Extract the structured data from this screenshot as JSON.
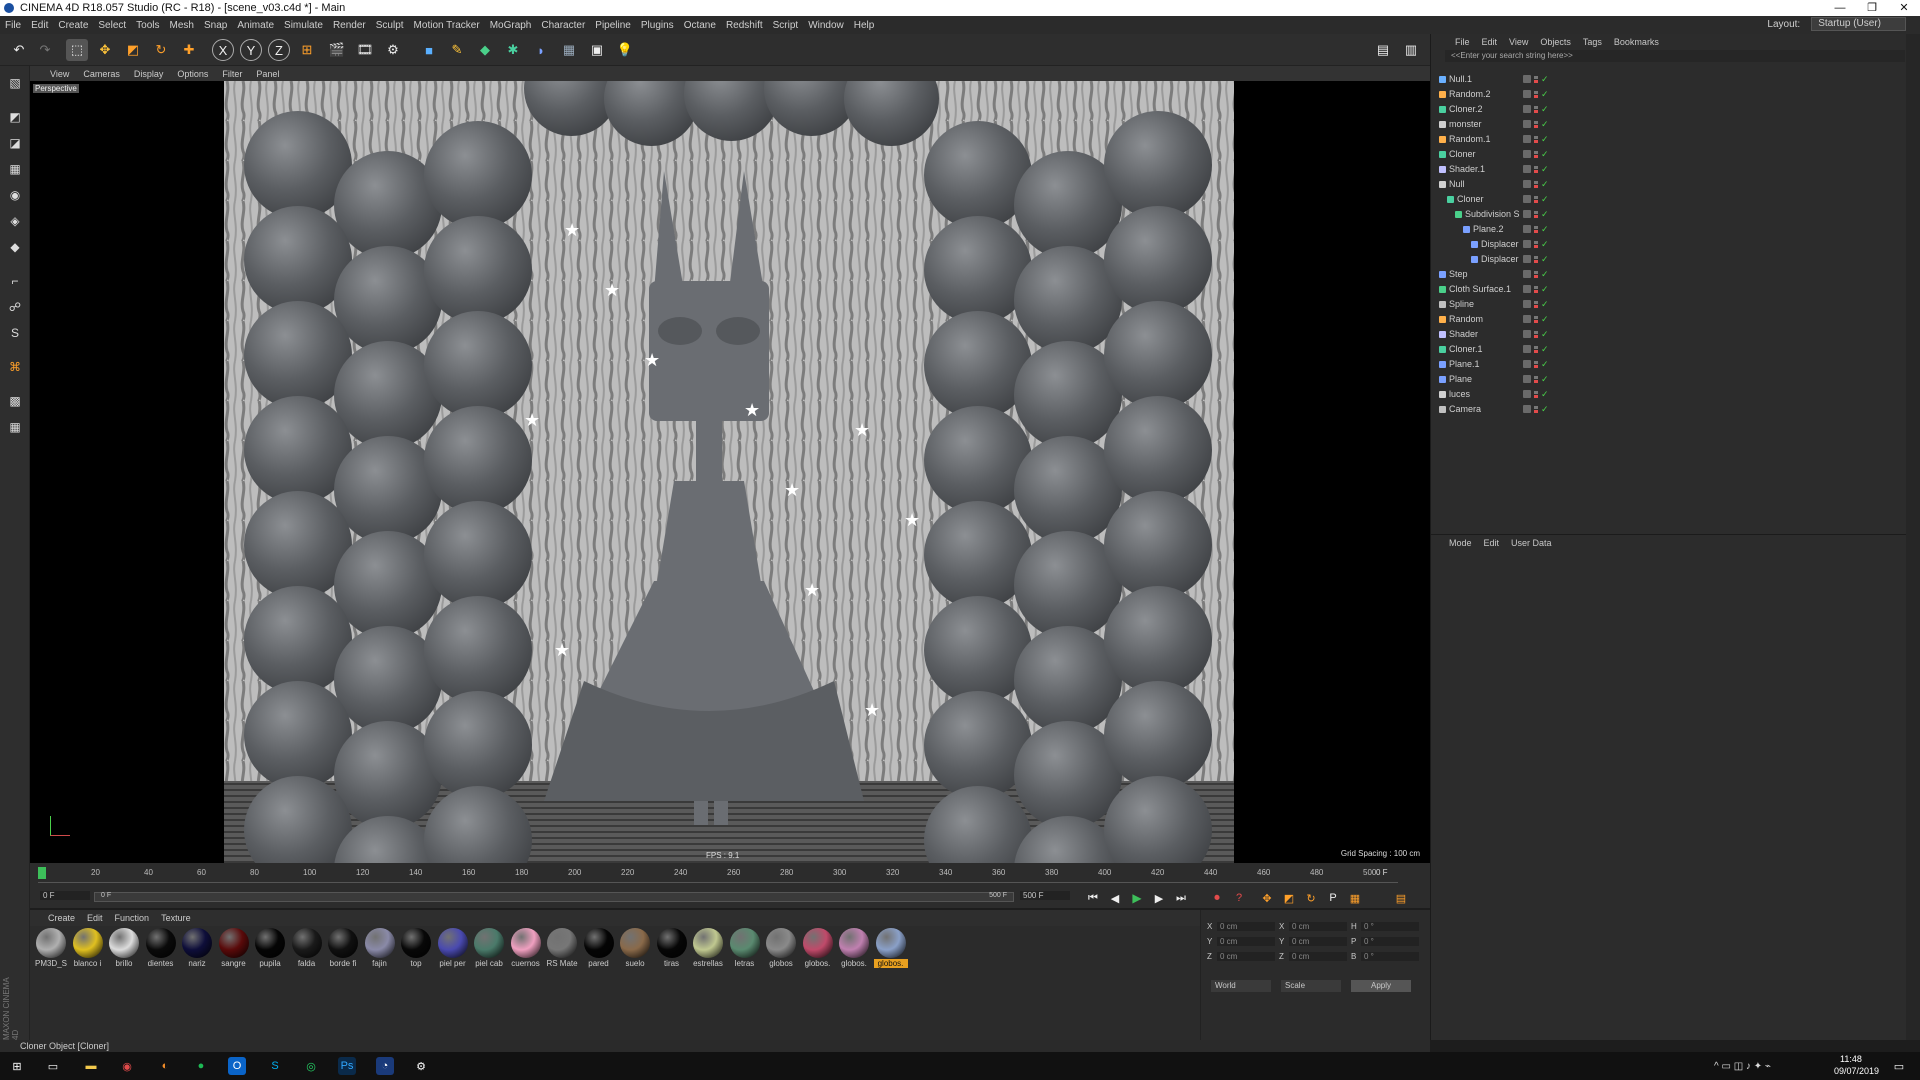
{
  "window": {
    "title": "CINEMA 4D R18.057 Studio (RC - R18) - [scene_v03.c4d *] - Main",
    "controls": [
      "—",
      "❐",
      "✕"
    ]
  },
  "menu": [
    "File",
    "Edit",
    "Create",
    "Select",
    "Tools",
    "Mesh",
    "Snap",
    "Animate",
    "Simulate",
    "Render",
    "Sculpt",
    "Motion Tracker",
    "MoGraph",
    "Character",
    "Pipeline",
    "Plugins",
    "Octane",
    "Redshift",
    "Script",
    "Window",
    "Help"
  ],
  "layout": {
    "label": "Layout:",
    "value": "Startup (User)"
  },
  "viewport": {
    "menu": [
      "View",
      "Cameras",
      "Display",
      "Options",
      "Filter",
      "Panel"
    ],
    "label": "Perspective",
    "fps": "FPS : 9.1",
    "grid_spacing": "Grid Spacing : 100 cm"
  },
  "timeline": {
    "ticks": [
      "0",
      "20",
      "40",
      "60",
      "80",
      "100",
      "120",
      "140",
      "160",
      "180",
      "200",
      "220",
      "240",
      "260",
      "280",
      "300",
      "320",
      "340",
      "360",
      "380",
      "400",
      "420",
      "440",
      "460",
      "480",
      "500"
    ],
    "current_frame": "0 F",
    "start_field": "0 F",
    "min_field": "0 F",
    "end_field": "500 F",
    "max_field": "500 F"
  },
  "materials": {
    "menu": [
      "Create",
      "Edit",
      "Function",
      "Texture"
    ],
    "items": [
      {
        "label": "PM3D_S",
        "color": "#b0b0b0"
      },
      {
        "label": "blanco i",
        "color": "#e0c020"
      },
      {
        "label": "brillo",
        "color": "#dcdcdc"
      },
      {
        "label": "dientes",
        "color": "#0a0a0a"
      },
      {
        "label": "nariz",
        "color": "#0e0e3a"
      },
      {
        "label": "sangre",
        "color": "#5a0a0a"
      },
      {
        "label": "pupila",
        "color": "#050505"
      },
      {
        "label": "falda",
        "color": "#1a1a1a"
      },
      {
        "label": "borde fi",
        "color": "#101010"
      },
      {
        "label": "fajin",
        "color": "#8a8aa8"
      },
      {
        "label": "top",
        "color": "#080808"
      },
      {
        "label": "piel per",
        "color": "#4a4ab0"
      },
      {
        "label": "piel cab",
        "color": "#4a7a6a"
      },
      {
        "label": "cuernos",
        "color": "#f0a0c0"
      },
      {
        "label": "RS Mate",
        "color": "#777777"
      },
      {
        "label": "pared",
        "color": "#050505"
      },
      {
        "label": "suelo",
        "color": "#8a6a4a"
      },
      {
        "label": "tiras",
        "color": "#060606"
      },
      {
        "label": "estrellas",
        "color": "#c0c890"
      },
      {
        "label": "letras",
        "color": "#5a8a70"
      },
      {
        "label": "globos",
        "color": "#8a8a8a"
      },
      {
        "label": "globos.",
        "color": "#c04a6a"
      },
      {
        "label": "globos.",
        "color": "#c080b0"
      },
      {
        "label": "globos.",
        "color": "#8aa0c8"
      }
    ]
  },
  "coords": {
    "rows": [
      {
        "a": "X",
        "av": "0 cm",
        "b": "X",
        "bv": "0 cm",
        "c": "H",
        "cv": "0 °"
      },
      {
        "a": "Y",
        "av": "0 cm",
        "b": "Y",
        "bv": "0 cm",
        "c": "P",
        "cv": "0 °"
      },
      {
        "a": "Z",
        "av": "0 cm",
        "b": "Z",
        "bv": "0 cm",
        "c": "B",
        "cv": "0 °"
      }
    ],
    "world": "World",
    "scale": "Scale",
    "apply": "Apply"
  },
  "object_manager": {
    "menu": [
      "File",
      "Edit",
      "View",
      "Objects",
      "Tags",
      "Bookmarks"
    ],
    "search_placeholder": "<<Enter your search string here>>",
    "objects": [
      {
        "name": "Null.1",
        "indent": 0
      },
      {
        "name": "Random.2",
        "indent": 0
      },
      {
        "name": "Cloner.2",
        "indent": 0
      },
      {
        "name": "monster",
        "indent": 0
      },
      {
        "name": "Random.1",
        "indent": 0
      },
      {
        "name": "Cloner",
        "indent": 0
      },
      {
        "name": "Shader.1",
        "indent": 0
      },
      {
        "name": "Null",
        "indent": 0
      },
      {
        "name": "Cloner",
        "indent": 1
      },
      {
        "name": "Subdivision S",
        "indent": 2
      },
      {
        "name": "Plane.2",
        "indent": 3
      },
      {
        "name": "Displacer",
        "indent": 4
      },
      {
        "name": "Displacer",
        "indent": 4
      },
      {
        "name": "Step",
        "indent": 0
      },
      {
        "name": "Cloth Surface.1",
        "indent": 0
      },
      {
        "name": "Spline",
        "indent": 0
      },
      {
        "name": "Random",
        "indent": 0
      },
      {
        "name": "Shader",
        "indent": 0
      },
      {
        "name": "Cloner.1",
        "indent": 0
      },
      {
        "name": "Plane.1",
        "indent": 0
      },
      {
        "name": "Plane",
        "indent": 0
      },
      {
        "name": "luces",
        "indent": 0
      },
      {
        "name": "Camera",
        "indent": 0
      }
    ]
  },
  "attribute_manager": {
    "menu": [
      "Mode",
      "Edit",
      "User Data"
    ]
  },
  "status": "Cloner Object [Cloner]",
  "taskbar": {
    "time": "11:48",
    "date": "09/07/2019"
  },
  "brand": "MAXON CINEMA 4D"
}
